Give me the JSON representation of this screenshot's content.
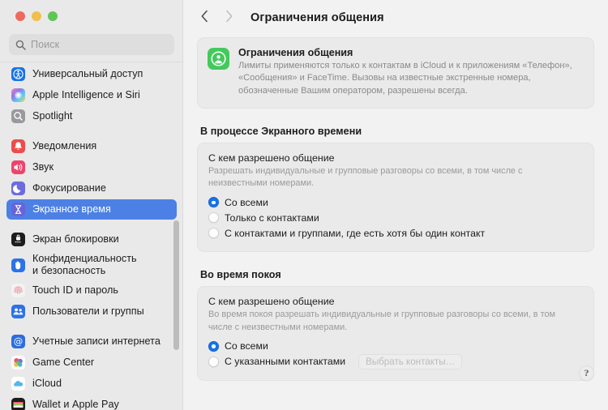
{
  "window": {
    "traffic_lights": {
      "close_color": "#ee6a5f",
      "minimize_color": "#f0bf4c",
      "maximize_color": "#61c555"
    }
  },
  "sidebar": {
    "search": {
      "placeholder": "Поиск",
      "value": "",
      "icon": "search-icon"
    },
    "groups": [
      {
        "items": [
          {
            "label": "Универсальный доступ",
            "icon": "accessibility-icon",
            "icon_color": "#1673e8",
            "selected": false
          },
          {
            "label": "Apple Intelligence и Siri",
            "icon": "siri-icon",
            "icon_color": "#8e7ae8",
            "selected": false
          },
          {
            "label": "Spotlight",
            "icon": "spotlight-search-icon",
            "icon_color": "#9a9a9e",
            "selected": false
          }
        ]
      },
      {
        "items": [
          {
            "label": "Уведомления",
            "icon": "bell-icon",
            "icon_color": "#ef4b4b",
            "selected": false
          },
          {
            "label": "Звук",
            "icon": "speaker-icon",
            "icon_color": "#f0436b",
            "selected": false
          },
          {
            "label": "Фокусирование",
            "icon": "moon-icon",
            "icon_color": "#6c6ce0",
            "selected": false
          },
          {
            "label": "Экранное время",
            "icon": "hourglass-icon",
            "icon_color": "#6a63d8",
            "selected": true
          }
        ]
      },
      {
        "items": [
          {
            "label": "Экран блокировки",
            "icon": "lock-screen-icon",
            "icon_color": "#1d1d1f",
            "selected": false
          },
          {
            "label": "Конфиденциальность\nи безопасность",
            "icon": "hand-privacy-icon",
            "icon_color": "#2c72e8",
            "selected": false
          },
          {
            "label": "Touch ID и пароль",
            "icon": "fingerprint-icon",
            "icon_color": "#f2f2f4",
            "selected": false
          },
          {
            "label": "Пользователи и группы",
            "icon": "users-group-icon",
            "icon_color": "#2c72e8",
            "selected": false
          }
        ]
      },
      {
        "items": [
          {
            "label": "Учетные записи интернета",
            "icon": "at-sign-icon",
            "icon_color": "#2c6de0",
            "selected": false
          },
          {
            "label": "Game Center",
            "icon": "game-center-icon",
            "icon_color": "#ffffff",
            "selected": false
          },
          {
            "label": "iCloud",
            "icon": "cloud-icon",
            "icon_color": "#ffffff",
            "selected": false
          },
          {
            "label": "Wallet и Apple Pay",
            "icon": "wallet-icon",
            "icon_color": "#1d1d1f",
            "selected": false
          }
        ]
      }
    ],
    "selected_accent_color": "#4d80e4"
  },
  "toolbar": {
    "back_icon": "chevron-left-icon",
    "forward_icon": "chevron-right-icon",
    "back_enabled": true,
    "forward_enabled": false,
    "title": "Ограничения общения"
  },
  "banner": {
    "icon": "person-in-circle-icon",
    "icon_color": "#43c95c",
    "title": "Ограничения общения",
    "description": "Лимиты применяются только к контактам в iCloud и к приложениям «Телефон», «Сообщения» и FaceTime. Вызовы на известные экстренные номера, обозначенные Вашим оператором, разрешены всегда."
  },
  "sections": [
    {
      "title": "В процессе Экранного времени",
      "group_heading": "С кем разрешено общение",
      "group_description": "Разрешать индивидуальные и групповые разговоры со всеми, в том числе с неизвестными номерами.",
      "options": [
        {
          "label": "Со всеми",
          "selected": true
        },
        {
          "label": "Только с контактами",
          "selected": false
        },
        {
          "label": "С контактами и группами, где есть хотя бы один контакт",
          "selected": false
        }
      ]
    },
    {
      "title": "Во время покоя",
      "group_heading": "С кем разрешено общение",
      "group_description": "Во время покоя разрешать индивидуальные и групповые разговоры со всеми, в том числе с неизвестными номерами.",
      "options": [
        {
          "label": "Со всеми",
          "selected": true
        },
        {
          "label": "С указанными контактами",
          "selected": false,
          "button_label": "Выбрать контакты…",
          "button_disabled": true
        }
      ]
    }
  ],
  "help": {
    "label": "?"
  },
  "colors": {
    "accent": "#1673e8",
    "sidebar_bg": "#e9e9e9",
    "main_bg": "#f2f2f2",
    "card_bg": "#eaeaea"
  }
}
